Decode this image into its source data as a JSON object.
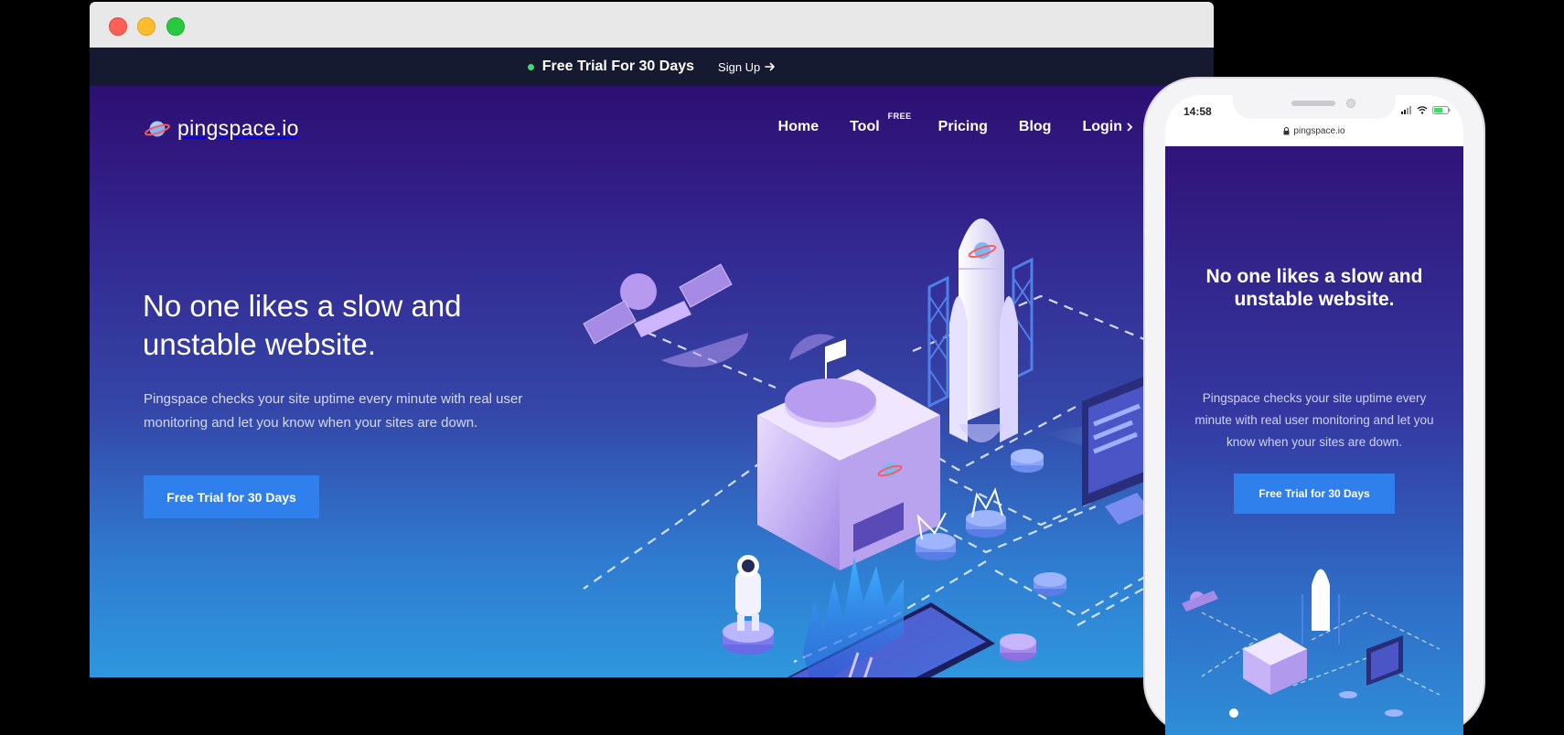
{
  "browser": {
    "window_controls": [
      "close",
      "minimize",
      "maximize"
    ]
  },
  "promo_bar": {
    "text": "Free Trial For 30 Days",
    "link_label": "Sign Up"
  },
  "header": {
    "logo_text": "pingspace.io",
    "nav": {
      "home": "Home",
      "tool": "Tool",
      "tool_badge": "FREE",
      "pricing": "Pricing",
      "blog": "Blog",
      "login": "Login"
    }
  },
  "hero": {
    "headline": "No one likes a slow and unstable website.",
    "subtext": "Pingspace checks your site uptime every minute with real user monitoring and let you know when your sites are down.",
    "cta_label": "Free Trial for 30 Days"
  },
  "mobile": {
    "time": "14:58",
    "url": "pingspace.io",
    "headline": "No one likes a slow and unstable website.",
    "subtext": "Pingspace checks your site uptime every minute with real user monitoring and let you know when your sites are down.",
    "cta_label": "Free Trial for 30 Days"
  },
  "colors": {
    "accent": "#2f80ed",
    "promo_bg": "#151a30",
    "status_dot": "#3ddc6b"
  }
}
